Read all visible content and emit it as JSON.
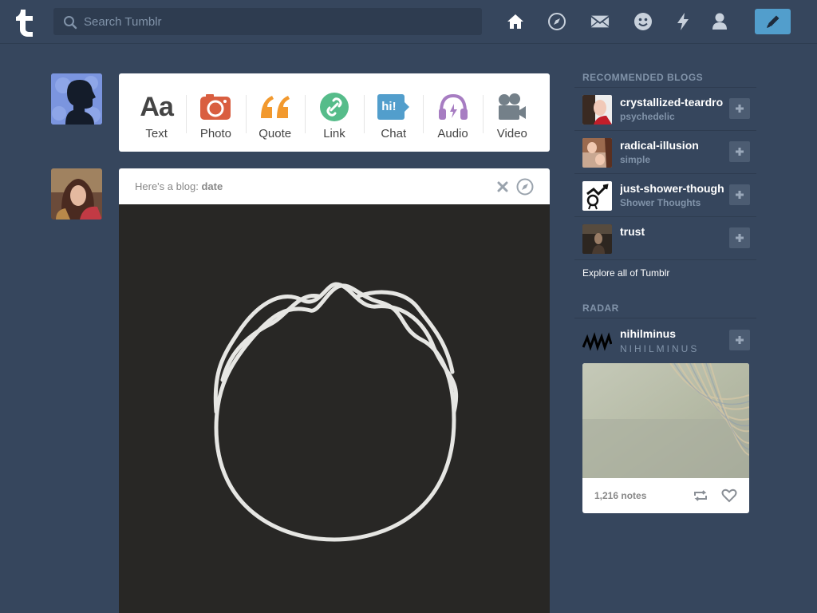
{
  "header": {
    "search_placeholder": "Search Tumblr",
    "nav": [
      "home-icon",
      "explore-icon",
      "inbox-icon",
      "messaging-icon",
      "activity-icon",
      "account-icon"
    ],
    "compose_icon": "pencil-icon"
  },
  "post_types": [
    {
      "label": "Text",
      "icon": "text-icon"
    },
    {
      "label": "Photo",
      "icon": "photo-icon"
    },
    {
      "label": "Quote",
      "icon": "quote-icon"
    },
    {
      "label": "Link",
      "icon": "link-icon"
    },
    {
      "label": "Chat",
      "icon": "chat-icon",
      "icon_text": "hi!"
    },
    {
      "label": "Audio",
      "icon": "audio-icon"
    },
    {
      "label": "Video",
      "icon": "video-icon"
    }
  ],
  "post": {
    "header_prefix": "Here's a blog:",
    "blog_name": "date"
  },
  "sidebar": {
    "recommended_title": "RECOMMENDED BLOGS",
    "blogs": [
      {
        "name": "crystallized-teardrops",
        "title": "psychedelic"
      },
      {
        "name": "radical-illusion",
        "title": "simple"
      },
      {
        "name": "just-shower-thoughts",
        "title": "Shower Thoughts"
      },
      {
        "name": "trust",
        "title": ""
      }
    ],
    "explore_link": "Explore all of Tumblr",
    "radar_title": "RADAR",
    "radar": {
      "name": "nihilminus",
      "title": "NIHILMINUS",
      "notes": "1,216 notes"
    }
  },
  "colors": {
    "background": "#36465d",
    "accent": "#529ecc",
    "muted": "#8193a9"
  }
}
